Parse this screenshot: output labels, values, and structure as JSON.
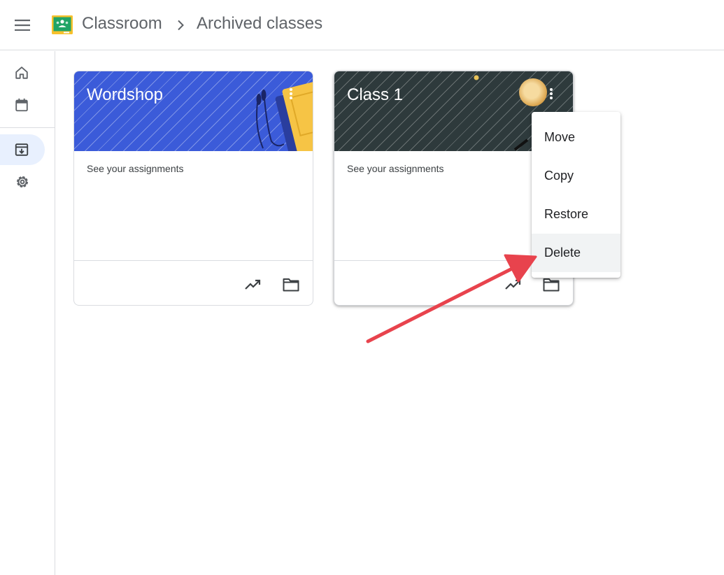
{
  "header": {
    "app_name": "Classroom",
    "breadcrumb": "Archived classes",
    "icons": {
      "menu": "hamburger-menu-icon",
      "logo": "classroom-logo",
      "separator": "chevron-right-icon"
    }
  },
  "sidebar": {
    "items": [
      {
        "name": "home",
        "icon": "home-icon"
      },
      {
        "name": "calendar",
        "icon": "calendar-icon"
      },
      {
        "name": "archived-classes",
        "icon": "archive-icon",
        "active": true
      },
      {
        "name": "settings",
        "icon": "gear-icon"
      }
    ]
  },
  "classes": [
    {
      "title": "Wordshop",
      "link": "See your assignments",
      "banner_color": "#3b5bd9",
      "icons": [
        "trending-up-icon",
        "folder-icon",
        "more-vert-icon"
      ]
    },
    {
      "title": "Class 1",
      "link": "See your assignments",
      "banner_color": "#2e3a3c",
      "icons": [
        "avatar",
        "trending-up-icon",
        "folder-icon",
        "more-vert-icon"
      ]
    }
  ],
  "context_menu": {
    "items": [
      "Move",
      "Copy",
      "Restore",
      "Delete"
    ],
    "highlighted": "Delete"
  },
  "annotation": {
    "type": "arrow",
    "color": "#e8434d",
    "points_to": "Delete"
  }
}
